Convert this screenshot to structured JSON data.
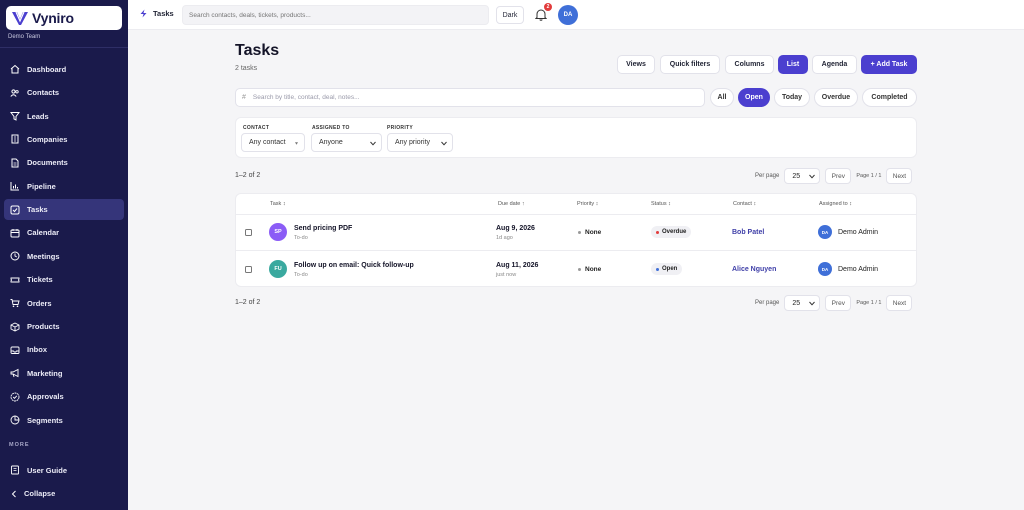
{
  "brand": {
    "name": "Vyniro",
    "team": "Demo Team"
  },
  "sidebar": {
    "items": [
      {
        "label": "Dashboard",
        "icon": "home-icon"
      },
      {
        "label": "Contacts",
        "icon": "contacts-icon"
      },
      {
        "label": "Leads",
        "icon": "funnel-icon"
      },
      {
        "label": "Companies",
        "icon": "building-icon"
      },
      {
        "label": "Documents",
        "icon": "document-icon"
      },
      {
        "label": "Pipeline",
        "icon": "chart-icon"
      },
      {
        "label": "Tasks",
        "icon": "check-square-icon",
        "active": true
      },
      {
        "label": "Calendar",
        "icon": "calendar-icon"
      },
      {
        "label": "Meetings",
        "icon": "clock-icon"
      },
      {
        "label": "Tickets",
        "icon": "ticket-icon"
      },
      {
        "label": "Orders",
        "icon": "cart-icon"
      },
      {
        "label": "Products",
        "icon": "box-icon"
      },
      {
        "label": "Inbox",
        "icon": "inbox-icon"
      },
      {
        "label": "Marketing",
        "icon": "megaphone-icon"
      },
      {
        "label": "Approvals",
        "icon": "badge-check-icon"
      },
      {
        "label": "Segments",
        "icon": "pie-icon"
      }
    ],
    "more_label": "MORE",
    "more_items": [
      {
        "label": "User Guide",
        "icon": "book-icon"
      }
    ],
    "collapse_label": "Collapse"
  },
  "topbar": {
    "breadcrumb": "Tasks",
    "search_placeholder": "Search contacts, deals, tickets, products...",
    "theme_label": "Dark",
    "notification_count": "2",
    "user_initials": "DA"
  },
  "header": {
    "title": "Tasks",
    "count": "2 tasks",
    "buttons": {
      "views": "Views",
      "quick_filters": "Quick filters",
      "columns": "Columns",
      "list": "List",
      "agenda": "Agenda",
      "add": "+ Add Task"
    }
  },
  "search": {
    "placeholder": "Search by title, contact, deal, notes...",
    "filters": [
      "All",
      "Open",
      "Today",
      "Overdue",
      "Completed"
    ],
    "active_filter": "Open"
  },
  "filters": {
    "contact": {
      "label": "CONTACT",
      "value": "Any contact"
    },
    "assigned": {
      "label": "ASSIGNED TO",
      "value": "Anyone"
    },
    "priority": {
      "label": "PRIORITY",
      "value": "Any priority"
    }
  },
  "pagination": {
    "range": "1–2 of 2",
    "per_page_label": "Per page",
    "per_page": "25",
    "prev": "Prev",
    "page_info": "Page 1 / 1",
    "next": "Next"
  },
  "table": {
    "columns": [
      "Task ↕",
      "Due date ↑",
      "Priority ↕",
      "Status ↕",
      "Contact ↕",
      "Assigned to ↕"
    ],
    "rows": [
      {
        "initials": "SP",
        "avatar_color": "#8b5cf6",
        "title": "Send pricing PDF",
        "type": "To-do",
        "due": "Aug 9, 2026",
        "due_sub": "1d ago",
        "priority": "None",
        "status": "Overdue",
        "status_color": "#e23b3b",
        "contact": "Bob Patel",
        "assignee_initials": "DA",
        "assignee": "Demo Admin"
      },
      {
        "initials": "FU",
        "avatar_color": "#3aa99f",
        "title": "Follow up on email: Quick follow-up",
        "type": "To-do",
        "due": "Aug 11, 2026",
        "due_sub": "just now",
        "priority": "None",
        "status": "Open",
        "status_color": "#3f6fd8",
        "contact": "Alice Nguyen",
        "assignee_initials": "DA",
        "assignee": "Demo Admin"
      }
    ]
  },
  "colors": {
    "sidebar_bg": "#1a1a4b",
    "accent": "#4b3fcf",
    "page_bg": "#f5f5f7"
  }
}
